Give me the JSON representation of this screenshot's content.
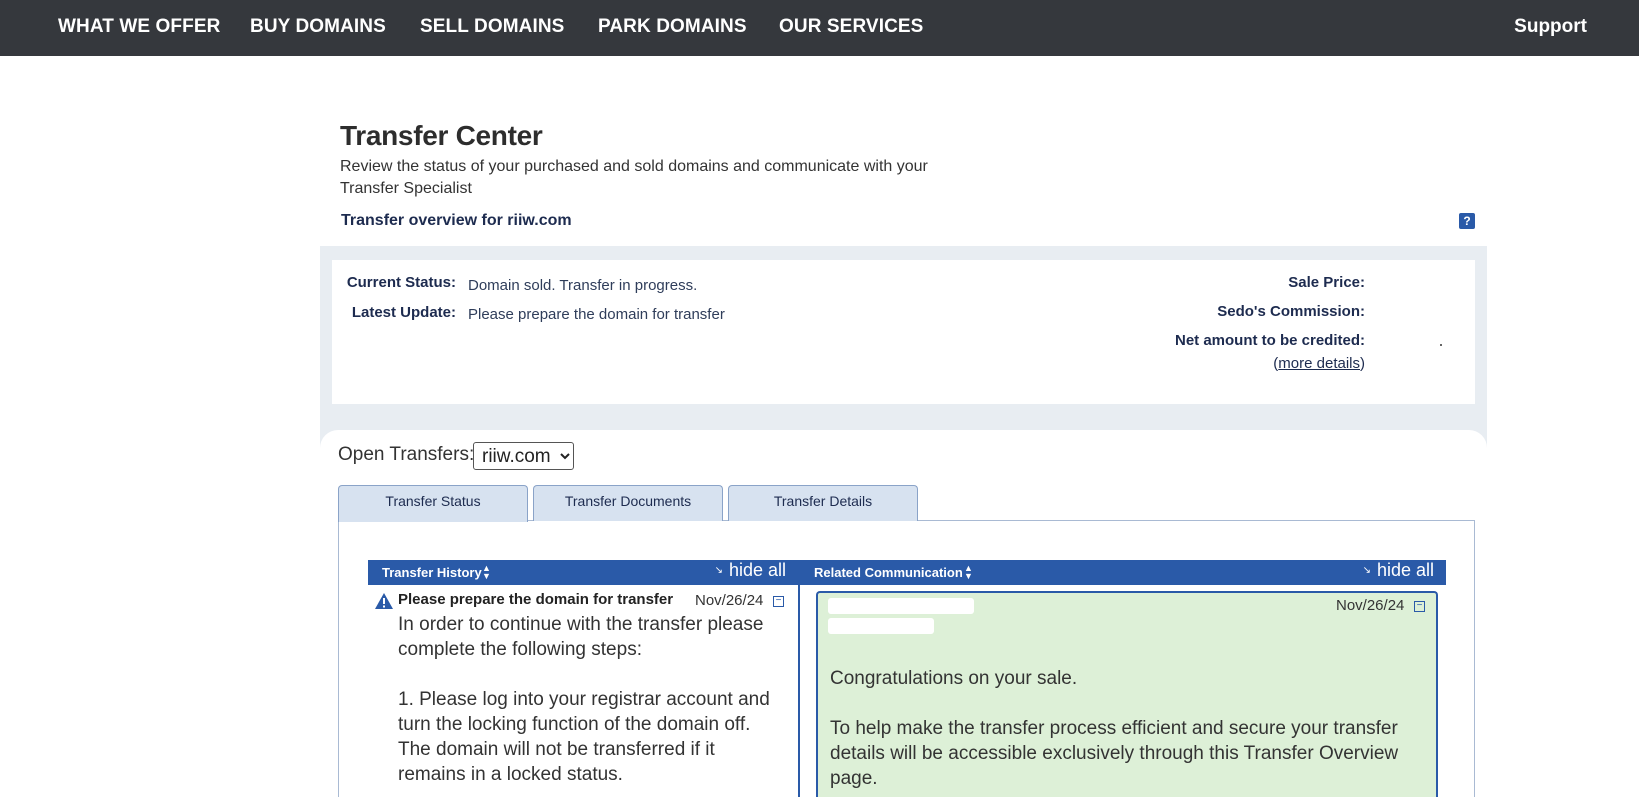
{
  "nav": {
    "items": [
      "WHAT WE OFFER",
      "BUY DOMAINS",
      "SELL DOMAINS",
      "PARK DOMAINS",
      "OUR SERVICES"
    ],
    "support": "Support"
  },
  "header": {
    "title": "Transfer Center",
    "subtitle": "Review the status of your purchased and sold domains and communicate with your Transfer Specialist",
    "overview_title": "Transfer overview for riiw.com",
    "help": "?"
  },
  "summary": {
    "current_status_label": "Current Status:",
    "current_status_value": "Domain sold. Transfer in progress.",
    "latest_update_label": "Latest Update:",
    "latest_update_value": "Please prepare the domain for transfer",
    "sale_price_label": "Sale Price:",
    "commission_label": "Sedo's Commission:",
    "net_amount_label": "Net amount to be credited:",
    "more_details": "more details"
  },
  "open_transfers": {
    "label": "Open Transfers:",
    "selected": "riiw.com"
  },
  "tabs": [
    {
      "label": "Transfer Status",
      "active": true
    },
    {
      "label": "Transfer Documents",
      "active": false
    },
    {
      "label": "Transfer Details",
      "active": false
    }
  ],
  "history": {
    "header": "Transfer History",
    "hide_all": "hide all",
    "item": {
      "title": "Please prepare the domain for transfer",
      "date": "Nov/26/24",
      "body": [
        "In order to continue with the transfer please complete the following steps:",
        "1. Please log into your registrar account and turn the locking function of the domain off. The domain will not be transferred if it remains in a locked status."
      ]
    }
  },
  "communication": {
    "header": "Related Communication",
    "hide_all": "hide all",
    "item": {
      "date": "Nov/26/24",
      "body": [
        "Congratulations on your sale.",
        "To help make the transfer process efficient and secure your transfer details will be accessible exclusively through this Transfer Overview page."
      ]
    }
  }
}
